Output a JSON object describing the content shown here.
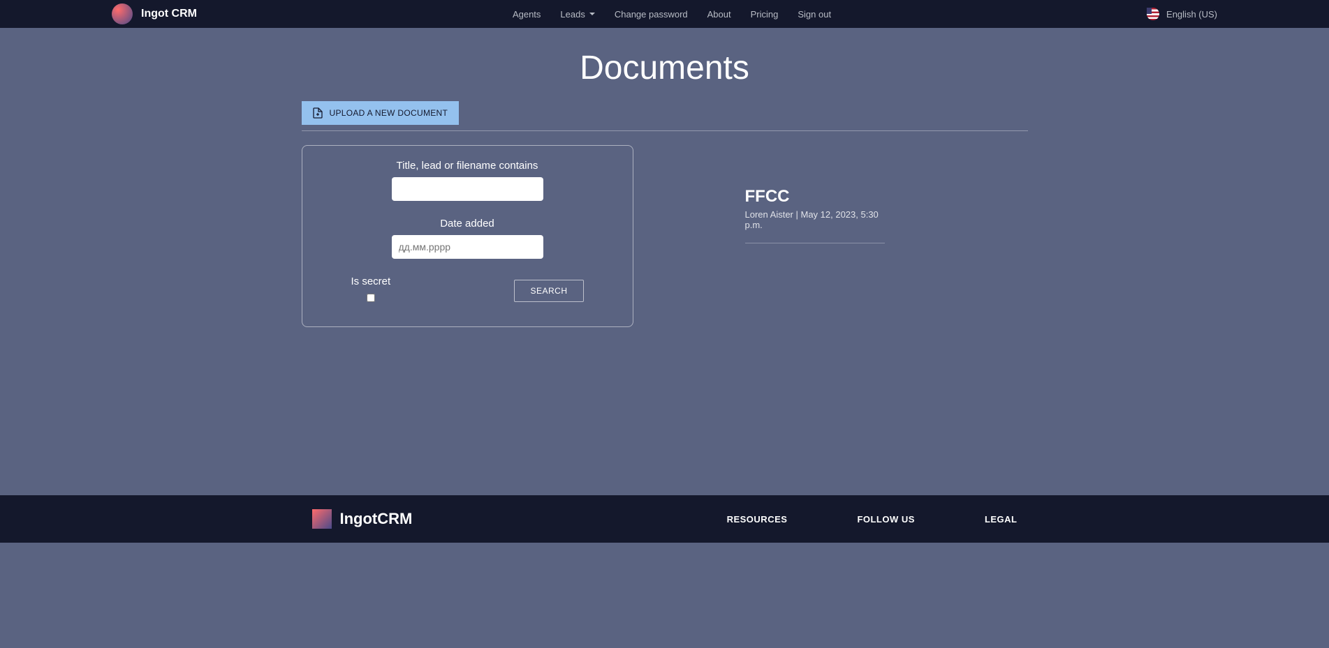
{
  "header": {
    "brand": "Ingot CRM",
    "nav": {
      "agents": "Agents",
      "leads": "Leads",
      "change_password": "Change password",
      "about": "About",
      "pricing": "Pricing",
      "sign_out": "Sign out"
    },
    "language": "English (US)"
  },
  "page": {
    "title": "Documents",
    "upload_button": "UPLOAD A NEW DOCUMENT"
  },
  "search_form": {
    "title_label": "Title, lead or filename contains",
    "date_label": "Date added",
    "date_placeholder": "дд.мм.рррр",
    "secret_label": "Is secret",
    "search_button": "SEARCH"
  },
  "documents": [
    {
      "title": "FFCC",
      "author": "Loren Aister",
      "timestamp": "May 12, 2023, 5:30 p.m."
    }
  ],
  "footer": {
    "brand": "IngotCRM",
    "sections": {
      "resources": "RESOURCES",
      "follow_us": "FOLLOW US",
      "legal": "LEGAL"
    }
  }
}
